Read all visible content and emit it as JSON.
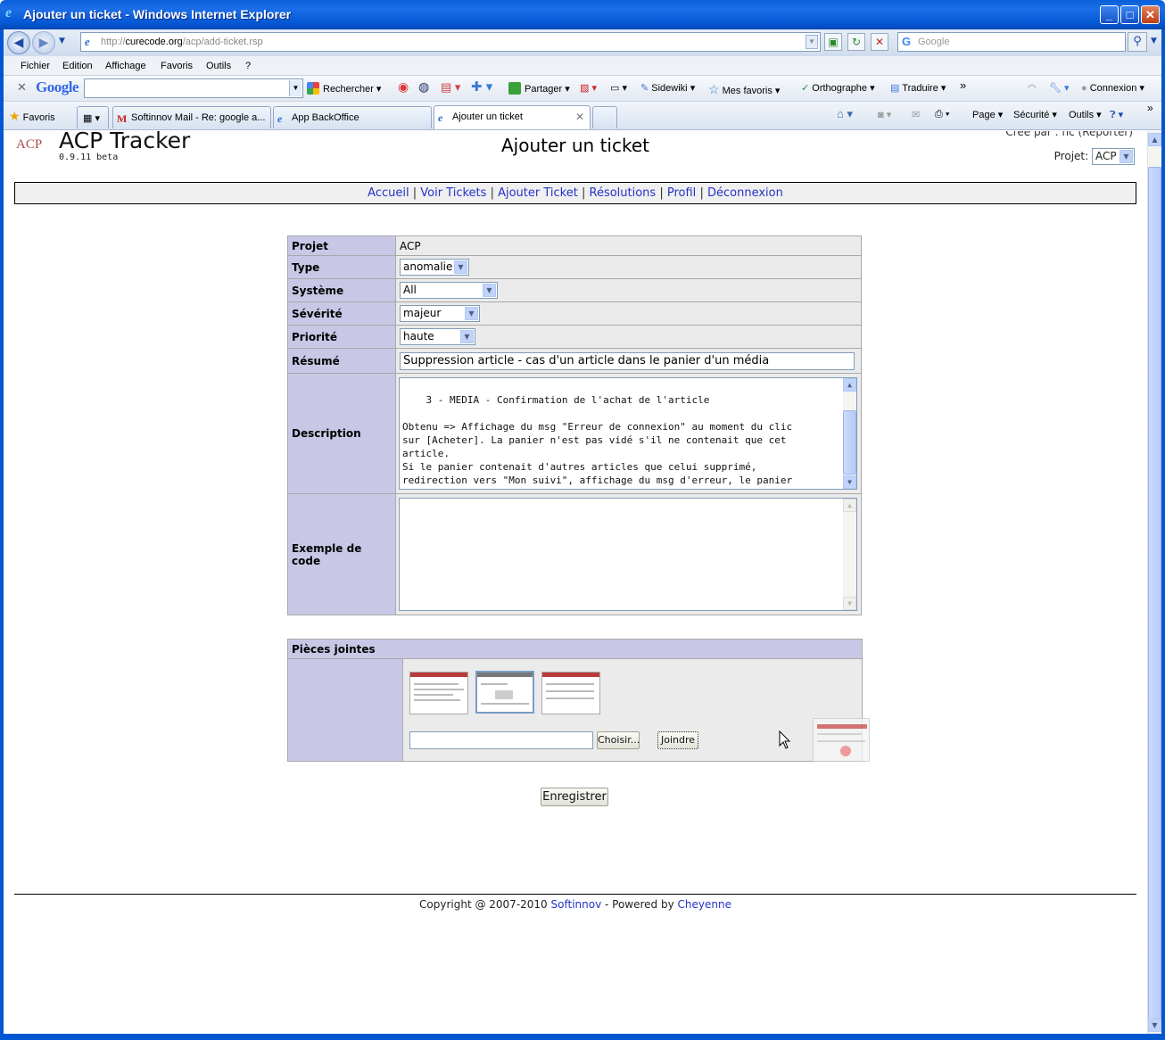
{
  "window": {
    "title": "Ajouter un ticket - Windows Internet Explorer"
  },
  "address": {
    "prefix": "http://",
    "host": "curecode.org",
    "path": "/acp/add-ticket.rsp"
  },
  "search": {
    "placeholder": "Google"
  },
  "menu": [
    "Fichier",
    "Edition",
    "Affichage",
    "Favoris",
    "Outils",
    "?"
  ],
  "google_toolbar": {
    "logo": "Google",
    "search_label": "Rechercher",
    "share_label": "Partager",
    "sidewiki_label": "Sidewiki",
    "favorites_label": "Mes favoris",
    "spell_label": "Orthographe",
    "translate_label": "Traduire",
    "connect_label": "Connexion"
  },
  "favbar": {
    "favorites_label": "Favoris",
    "tabs": [
      {
        "label": "Softinnov Mail - Re: google a..."
      },
      {
        "label": "App BackOffice"
      },
      {
        "label": "Ajouter un ticket"
      }
    ],
    "page_label": "Page",
    "security_label": "Sécurité",
    "tools_label": "Outils"
  },
  "app": {
    "logo_text": "ACP",
    "name": "ACP Tracker",
    "version": "0.9.11 beta",
    "page_title": "Ajouter un ticket",
    "creator": "Créé par : nc (Reporter)",
    "project_label": "Projet:",
    "project_value": "ACP"
  },
  "nav": {
    "home": "Accueil",
    "tickets": "Voir Tickets",
    "add": "Ajouter Ticket",
    "resolutions": "Résolutions",
    "profile": "Profil",
    "logout": "Déconnexion",
    "sep": "|"
  },
  "form": {
    "project": {
      "label": "Projet",
      "value": "ACP"
    },
    "type": {
      "label": "Type",
      "value": "anomalie"
    },
    "system": {
      "label": "Système",
      "value": "All"
    },
    "severity": {
      "label": "Sévérité",
      "value": "majeur"
    },
    "priority": {
      "label": "Priorité",
      "value": "haute"
    },
    "summary": {
      "label": "Résumé",
      "value": "Suppression article -  cas d'un article dans le panier d'un média"
    },
    "description": {
      "label": "Description",
      "value": "3 - MEDIA - Confirmation de l'achat de l'article\n\nObtenu => Affichage du msg \"Erreur de connexion\" au moment du clic\nsur [Acheter]. La panier n'est pas vidé s'il ne contenait que cet\narticle.\nSi le panier contenait d'autres articles que celui supprimé,\nredirection vers \"Mon suivi\", affichage du msg d'erreur, le panier\nest vidé."
    },
    "code": {
      "label": "Exemple de code",
      "value": ""
    }
  },
  "attachments": {
    "label": "Pièces jointes",
    "choose_label": "Choisir...",
    "join_label": "Joindre",
    "file_value": ""
  },
  "save_label": "Enregistrer",
  "footer": {
    "prefix": "Copyright @ 2007-2010 ",
    "company": "Softinnov",
    "middle": " - Powered by ",
    "engine": "Cheyenne"
  }
}
